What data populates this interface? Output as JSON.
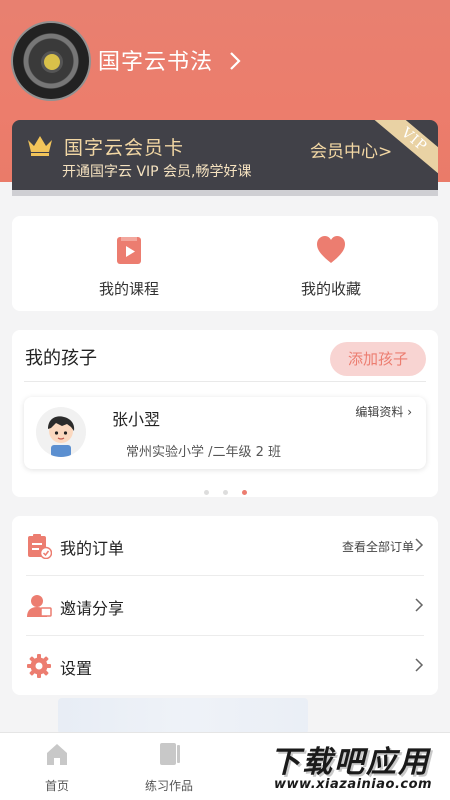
{
  "profile": {
    "app_name": "国字云书法"
  },
  "vip": {
    "title": "国字云会员卡",
    "subtitle": "开通国字云 VIP 会员,畅学好课",
    "center_link": "会员中心>",
    "ribbon": "VIP"
  },
  "quick": {
    "items": [
      {
        "label": "我的课程",
        "icon": "course-icon"
      },
      {
        "label": "我的收藏",
        "icon": "heart-icon"
      }
    ]
  },
  "kids": {
    "title": "我的孩子",
    "add_label": "添加孩子",
    "child": {
      "name": "张小翌",
      "school": "常州实验小学 /二年级 2 班",
      "edit_label": "编辑资料 ›"
    },
    "carousel": {
      "pages": 3,
      "active_index": 2
    }
  },
  "menu": {
    "items": [
      {
        "label": "我的订单",
        "side": "查看全部订单",
        "icon": "order-icon"
      },
      {
        "label": "邀请分享",
        "side": "",
        "icon": "invite-icon"
      },
      {
        "label": "设置",
        "side": "",
        "icon": "gear-icon"
      }
    ]
  },
  "tabbar": {
    "items": [
      {
        "label": "首页",
        "icon": "home-icon"
      },
      {
        "label": "练习作品",
        "icon": "practice-icon"
      }
    ]
  },
  "watermark": {
    "main": "下载吧应用",
    "url": "www.xiazainiao.com"
  },
  "colors": {
    "accent": "#ec7d70",
    "vip_bg": "#414148",
    "vip_gold": "#f2d7a4"
  }
}
